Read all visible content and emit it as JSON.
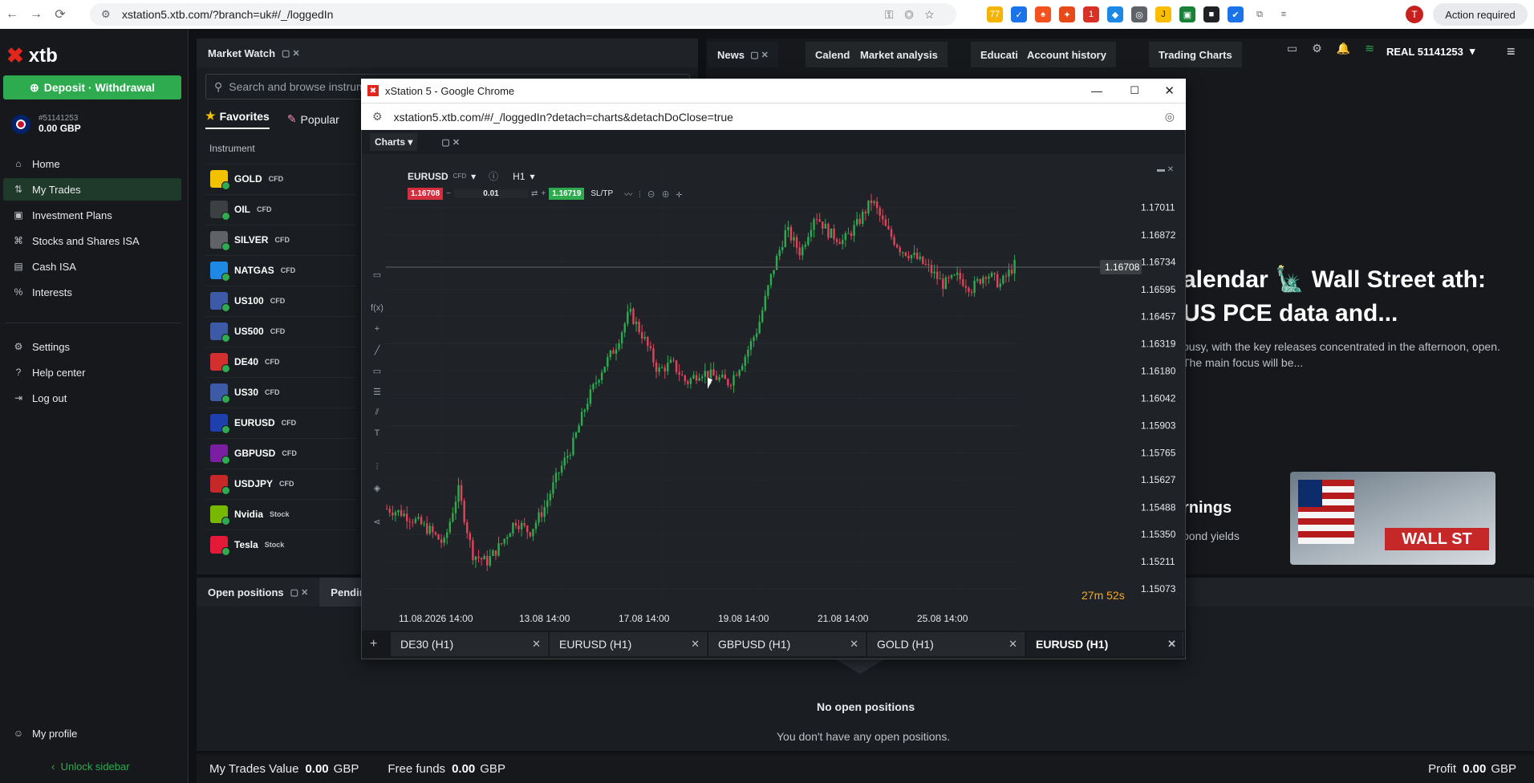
{
  "browser": {
    "url": "xstation5.xtb.com/?branch=uk#/_/loggedIn",
    "action_required": "Action required",
    "profile_initial": "T",
    "badge_count": "77",
    "badge_count2": "1"
  },
  "sidebar": {
    "logo_text": "xtb",
    "deposit_label": "Deposit · Withdrawal",
    "account_number": "#51141253",
    "account_balance": "0.00 GBP",
    "items": [
      {
        "label": "Home",
        "icon": "home-icon"
      },
      {
        "label": "My Trades",
        "icon": "trades-icon"
      },
      {
        "label": "Investment Plans",
        "icon": "plans-icon"
      },
      {
        "label": "Stocks and Shares ISA",
        "icon": "isa-icon"
      },
      {
        "label": "Cash ISA",
        "icon": "cash-isa-icon"
      },
      {
        "label": "Interests",
        "icon": "percent-icon"
      }
    ],
    "items2": [
      {
        "label": "Settings"
      },
      {
        "label": "Help center"
      },
      {
        "label": "Log out"
      }
    ],
    "my_profile": "My profile",
    "unlock": "Unlock sidebar"
  },
  "market_watch": {
    "tab_label": "Market Watch",
    "search_placeholder": "Search and browse instrum",
    "filters": [
      "Favorites",
      "Popular"
    ],
    "column_instrument": "Instrument",
    "instruments": [
      {
        "name": "GOLD",
        "type": "CFD",
        "color": "#f2c200"
      },
      {
        "name": "OIL",
        "type": "CFD",
        "color": "#3c4043"
      },
      {
        "name": "SILVER",
        "type": "CFD",
        "color": "#5f6368"
      },
      {
        "name": "NATGAS",
        "type": "CFD",
        "color": "#1e88e5"
      },
      {
        "name": "US100",
        "type": "CFD",
        "color": "#3c5aa6"
      },
      {
        "name": "US500",
        "type": "CFD",
        "color": "#3c5aa6"
      },
      {
        "name": "DE40",
        "type": "CFD",
        "color": "#d32f2f"
      },
      {
        "name": "US30",
        "type": "CFD",
        "color": "#3c5aa6"
      },
      {
        "name": "EURUSD",
        "type": "CFD",
        "color": "#1e40af"
      },
      {
        "name": "GBPUSD",
        "type": "CFD",
        "color": "#7b1fa2"
      },
      {
        "name": "USDJPY",
        "type": "CFD",
        "color": "#c62828"
      },
      {
        "name": "Nvidia",
        "type": "Stock",
        "color": "#76b900"
      },
      {
        "name": "Tesla",
        "type": "Stock",
        "color": "#e31937"
      }
    ]
  },
  "top_tabs": [
    "News",
    "Calendar",
    "Market analysis",
    "Education",
    "Account history",
    "Trading Charts"
  ],
  "account_label": "REAL 51141253",
  "news": {
    "headline": "alendar 🗽 Wall Street ath: US PCE data and...",
    "summary": "busy, with the key releases concentrated in the afternoon, open. The main focus will be...",
    "second_title": "rnings",
    "second_sub": "bond yields",
    "image_text": "WALL ST"
  },
  "positions": {
    "tab_label": "Open positions",
    "tab2_label": "Pendin",
    "empty_title": "No open positions",
    "empty_sub": "You don't have any open positions."
  },
  "footer": {
    "trades_label": "My Trades Value",
    "trades_value": "0.00",
    "trades_ccy": "GBP",
    "free_label": "Free funds",
    "free_value": "0.00",
    "free_ccy": "GBP",
    "profit_label": "Profit",
    "profit_value": "0.00",
    "profit_ccy": "GBP"
  },
  "popup": {
    "title": "xStation 5 - Google Chrome",
    "url": "xstation5.xtb.com/#/_/loggedIn?detach=charts&detachDoClose=true",
    "charts_label": "Charts",
    "symbol": "EURUSD",
    "symbol_type": "CFD",
    "timeframe": "H1",
    "bid": "1.16708",
    "volume": "0.01",
    "ask": "1.16719",
    "sltp": "SL/TP",
    "countdown_min": "27m",
    "countdown_sec": "52s",
    "chart_tabs": [
      "DE30 (H1)",
      "EURUSD (H1)",
      "GBPUSD (H1)",
      "GOLD (H1)",
      "EURUSD (H1)"
    ]
  },
  "chart_data": {
    "type": "candlestick",
    "symbol": "EURUSD",
    "timeframe": "H1",
    "current_price": 1.16708,
    "y_ticks": [
      1.17011,
      1.16872,
      1.16734,
      1.16595,
      1.16457,
      1.16319,
      1.1618,
      1.16042,
      1.15903,
      1.15765,
      1.15627,
      1.15488,
      1.1535,
      1.15211,
      1.15073
    ],
    "y_tick_labels": [
      "1.17011",
      "1.16872",
      "1.16734",
      "1.16595",
      "1.16457",
      "1.16319",
      "1.16180",
      "1.16042",
      "1.15903",
      "1.15765",
      "1.15627",
      "1.15488",
      "1.15350",
      "1.15211",
      "1.15073"
    ],
    "ylim": [
      1.15,
      1.1712
    ],
    "x_tick_labels": [
      "11.08.2026 14:00",
      "13.08 14:00",
      "17.08 14:00",
      "19.08 14:00",
      "21.08 14:00",
      "25.08 14:00"
    ],
    "price_path": [
      1.1548,
      1.1546,
      1.1542,
      1.1537,
      1.153,
      1.1558,
      1.1525,
      1.1521,
      1.153,
      1.1542,
      1.1536,
      1.1548,
      1.1566,
      1.158,
      1.1602,
      1.1618,
      1.163,
      1.1648,
      1.1635,
      1.1618,
      1.1622,
      1.1612,
      1.1618,
      1.1615,
      1.1612,
      1.1624,
      1.164,
      1.1668,
      1.169,
      1.1678,
      1.1698,
      1.1688,
      1.1684,
      1.1693,
      1.1705,
      1.169,
      1.168,
      1.1676,
      1.167,
      1.1662,
      1.1666,
      1.166,
      1.1668,
      1.1662,
      1.1672
    ]
  }
}
